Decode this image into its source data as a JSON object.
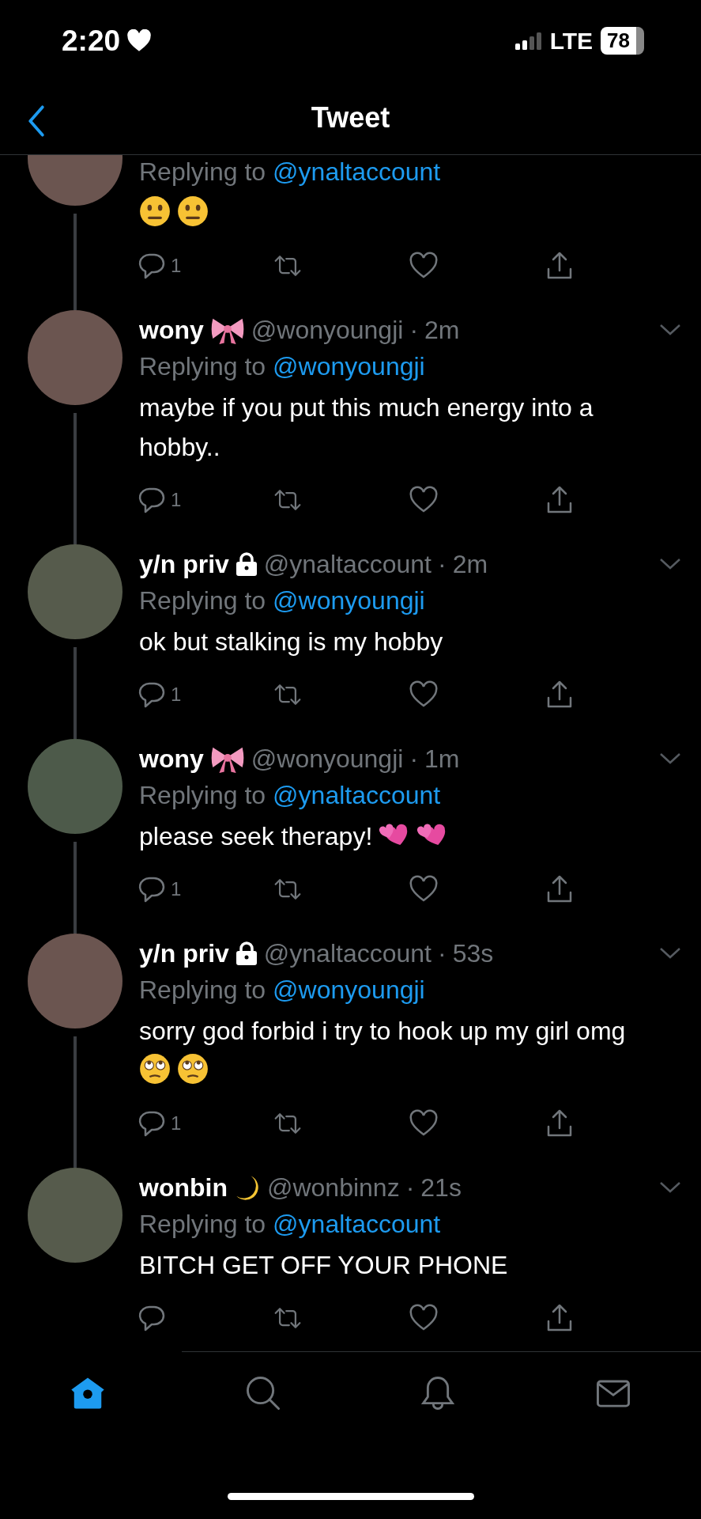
{
  "status_bar": {
    "time": "2:20",
    "network": "LTE",
    "battery": "78"
  },
  "header": {
    "title": "Tweet"
  },
  "tweets": [
    {
      "replying_label": "Replying to",
      "replying_to": "@ynaltaccount",
      "emoji": [
        {
          "kind": "neutral-face"
        },
        {
          "kind": "neutral-face"
        }
      ],
      "reply_count": "1",
      "thread_line": true
    },
    {
      "name": "wony",
      "badge": {
        "kind": "bow"
      },
      "handle": "@wonyoungji",
      "separator": "·",
      "time": "2m",
      "replying_label": "Replying to",
      "replying_to": "@wonyoungji",
      "text": "maybe if you put this much energy into a hobby..",
      "reply_count": "1",
      "thread_line": true
    },
    {
      "name": "y/n priv",
      "badge": {
        "kind": "lock"
      },
      "handle": "@ynaltaccount",
      "separator": "·",
      "time": "2m",
      "replying_label": "Replying to",
      "replying_to": "@wonyoungji",
      "text": "ok but stalking is my hobby",
      "reply_count": "1",
      "thread_line": true
    },
    {
      "name": "wony",
      "badge": {
        "kind": "bow"
      },
      "handle": "@wonyoungji",
      "separator": "·",
      "time": "1m",
      "replying_label": "Replying to",
      "replying_to": "@ynaltaccount",
      "text": "please seek therapy!",
      "emoji": [
        {
          "kind": "hearts"
        },
        {
          "kind": "hearts"
        }
      ],
      "reply_count": "1",
      "thread_line": true
    },
    {
      "name": "y/n priv",
      "badge": {
        "kind": "lock"
      },
      "handle": "@ynaltaccount",
      "separator": "·",
      "time": "53s",
      "replying_label": "Replying to",
      "replying_to": "@wonyoungji",
      "text": "sorry god forbid i try to hook up my girl omg",
      "emoji": [
        {
          "kind": "eye-roll"
        },
        {
          "kind": "eye-roll"
        }
      ],
      "reply_count": "1",
      "thread_line": true
    },
    {
      "name": "wonbin",
      "badge": {
        "kind": "moon"
      },
      "handle": "@wonbinnz",
      "separator": "·",
      "time": "21s",
      "replying_label": "Replying to",
      "replying_to": "@ynaltaccount",
      "text": "BITCH GET OFF YOUR PHONE",
      "thread_line": false
    }
  ],
  "tab_bar": [
    {
      "kind": "home",
      "selected": true
    },
    {
      "kind": "search",
      "selected": false
    },
    {
      "kind": "notifications",
      "selected": false
    },
    {
      "kind": "messages",
      "selected": false
    }
  ]
}
